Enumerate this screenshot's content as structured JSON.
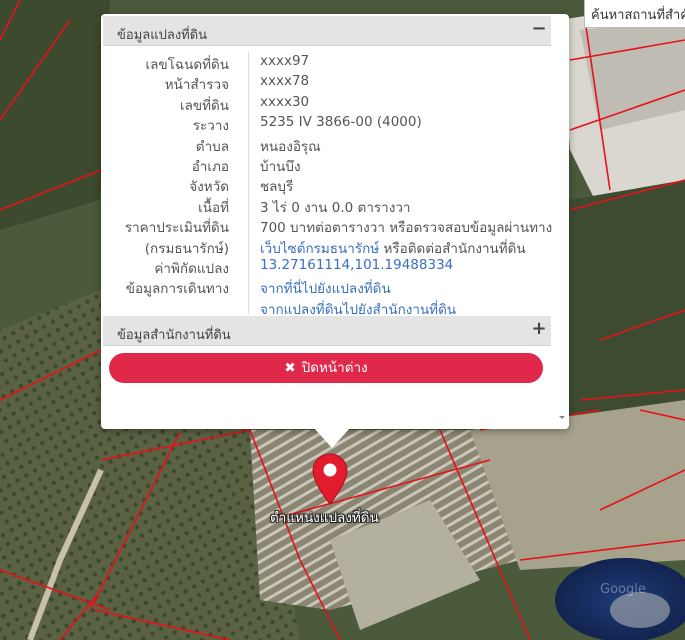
{
  "search": {
    "placeholder": "ค้นหาสถานที่สำคัญ"
  },
  "popup": {
    "section1_title": "ข้อมูลแปลงที่ดิน",
    "section1_toggle": "−",
    "section2_title": "ข้อมูลสำนักงานที่ดิน",
    "section2_toggle": "+",
    "rows": [
      {
        "key": "เลขโฉนดที่ดิน",
        "value": "xxxx97"
      },
      {
        "key": "หน้าสำรวจ",
        "value": "xxxx78"
      },
      {
        "key": "เลขที่ดิน",
        "value": "xxxx30"
      },
      {
        "key": "ระวาง",
        "value": "5235 IV 3866-00 (4000)"
      },
      {
        "key": "ตำบล",
        "value": "หนองอิรุณ"
      },
      {
        "key": "อำเภอ",
        "value": "บ้านบึง"
      },
      {
        "key": "จังหวัด",
        "value": "ชลบุรี"
      },
      {
        "key": "เนื้อที่",
        "value": "3 ไร่ 0 งาน 0.0 ตารางวา"
      },
      {
        "key": "ราคาประเมินที่ดิน",
        "value": "700 บาทต่อตารางวา หรือตรวจสอบข้อมูลผ่านทาง"
      },
      {
        "key": "(กรมธนารักษ์)",
        "link": "เว็บไซต์กรมธนารักษ์",
        "value_suffix": " หรือติดต่อสำนักงานที่ดิน"
      },
      {
        "key": "ค่าพิกัดแปลง",
        "link": "13.27161114,101.19488334"
      },
      {
        "key": "ข้อมูลการเดินทาง",
        "link": "จากที่นี่ไปยังแปลงที่ดิน"
      },
      {
        "key": "",
        "link": "จากแปลงที่ดินไปยังสำนักงานที่ดิน"
      }
    ],
    "close_label": "ปิดหน้าต่าง",
    "close_icon": "✖"
  },
  "marker": {
    "label": "ตำแหน่งแปลงที่ดิน",
    "icon": "map-pin-icon",
    "color": "#e21c2c"
  },
  "colors": {
    "accent": "#e0294a",
    "link": "#3a6fbf",
    "parcel_line": "#e8101a"
  },
  "watermark": "Google"
}
